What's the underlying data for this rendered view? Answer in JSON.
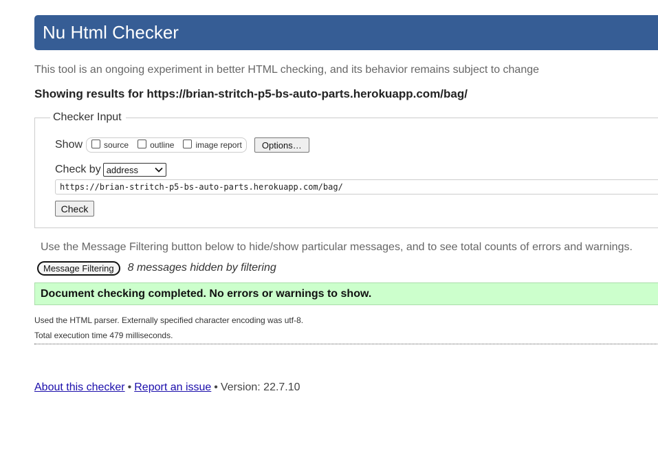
{
  "header": {
    "title": "Nu Html Checker"
  },
  "intro": "This tool is an ongoing experiment in better HTML checking, and its behavior remains subject to change",
  "results_for": "Showing results for https://brian-stritch-p5-bs-auto-parts.herokuapp.com/bag/",
  "checker_input": {
    "legend": "Checker Input",
    "show_label": "Show",
    "show_options": [
      {
        "label": "source",
        "checked": false
      },
      {
        "label": "outline",
        "checked": false
      },
      {
        "label": "image report",
        "checked": false
      }
    ],
    "options_button": "Options…",
    "check_by_label": "Check by",
    "check_by_value": "address",
    "url_value": "https://brian-stritch-p5-bs-auto-parts.herokuapp.com/bag/",
    "check_button": "Check"
  },
  "filtering": {
    "note": "Use the Message Filtering button below to hide/show particular messages, and to see total counts of errors and warnings.",
    "button": "Message Filtering",
    "hidden_count": "8 messages hidden by filtering"
  },
  "result": {
    "message": "Document checking completed. No errors or warnings to show.",
    "status_color": "#ccffcc",
    "details": [
      "Used the HTML parser. Externally specified character encoding was utf-8.",
      "Total execution time 479 milliseconds."
    ]
  },
  "footer": {
    "about_link": "About this checker",
    "separator": "•",
    "report_link": "Report an issue",
    "version": "Version: 22.7.10"
  },
  "colors": {
    "header_bg": "#365d95",
    "link": "#1a0dab"
  }
}
